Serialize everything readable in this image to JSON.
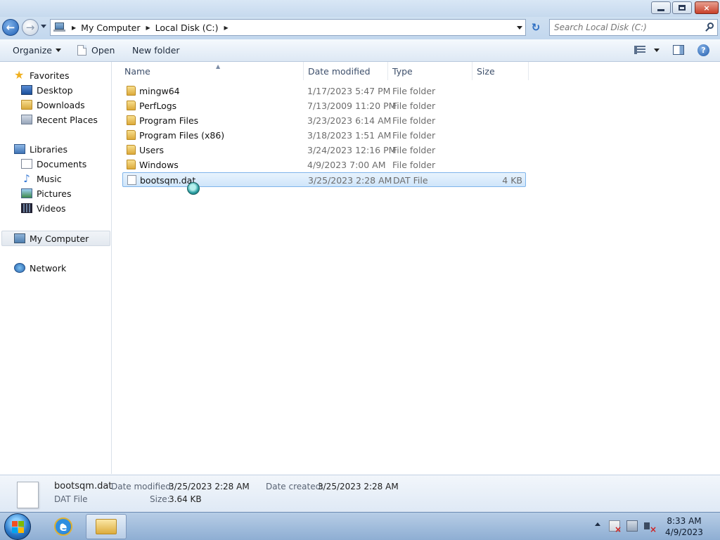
{
  "window": {
    "minimize_label": "",
    "maximize_label": "",
    "close_label": "×"
  },
  "nav": {
    "back_glyph": "←",
    "forward_glyph": "→",
    "refresh_glyph": "↻",
    "breadcrumbs": [
      "My Computer",
      "Local Disk (C:)"
    ],
    "search_placeholder": "Search Local Disk (C:)"
  },
  "toolbar": {
    "organize_label": "Organize",
    "open_label": "Open",
    "new_folder_label": "New folder",
    "help_label": "?"
  },
  "sidebar": {
    "favorites_label": "Favorites",
    "favorites": [
      {
        "label": "Desktop",
        "icon": "desktop-icon"
      },
      {
        "label": "Downloads",
        "icon": "downloads-folder-icon"
      },
      {
        "label": "Recent Places",
        "icon": "recent-places-icon"
      }
    ],
    "libraries_label": "Libraries",
    "libraries": [
      {
        "label": "Documents",
        "icon": "documents-icon"
      },
      {
        "label": "Music",
        "icon": "music-icon"
      },
      {
        "label": "Pictures",
        "icon": "pictures-icon"
      },
      {
        "label": "Videos",
        "icon": "videos-icon"
      }
    ],
    "computer_label": "My Computer",
    "network_label": "Network"
  },
  "columns": {
    "name": "Name",
    "date": "Date modified",
    "type": "Type",
    "size": "Size"
  },
  "files": [
    {
      "name": "mingw64",
      "date": "1/17/2023 5:47 PM",
      "type": "File folder",
      "size": "",
      "kind": "folder"
    },
    {
      "name": "PerfLogs",
      "date": "7/13/2009 11:20 PM",
      "type": "File folder",
      "size": "",
      "kind": "folder"
    },
    {
      "name": "Program Files",
      "date": "3/23/2023 6:14 AM",
      "type": "File folder",
      "size": "",
      "kind": "folder"
    },
    {
      "name": "Program Files (x86)",
      "date": "3/18/2023 1:51 AM",
      "type": "File folder",
      "size": "",
      "kind": "folder"
    },
    {
      "name": "Users",
      "date": "3/24/2023 12:16 PM",
      "type": "File folder",
      "size": "",
      "kind": "folder"
    },
    {
      "name": "Windows",
      "date": "4/9/2023 7:00 AM",
      "type": "File folder",
      "size": "",
      "kind": "folder"
    },
    {
      "name": "bootsqm.dat",
      "date": "3/25/2023 2:28 AM",
      "type": "DAT File",
      "size": "4 KB",
      "kind": "file",
      "selected": true
    }
  ],
  "details": {
    "filename": "bootsqm.dat",
    "filetype": "DAT File",
    "date_modified_label": "Date modified:",
    "date_modified": "3/25/2023 2:28 AM",
    "date_created_label": "Date created:",
    "date_created": "3/25/2023 2:28 AM",
    "size_label": "Size:",
    "size": "3.64 KB"
  },
  "taskbar": {
    "time": "8:33 AM",
    "date": "4/9/2023",
    "ie_glyph": "e"
  }
}
